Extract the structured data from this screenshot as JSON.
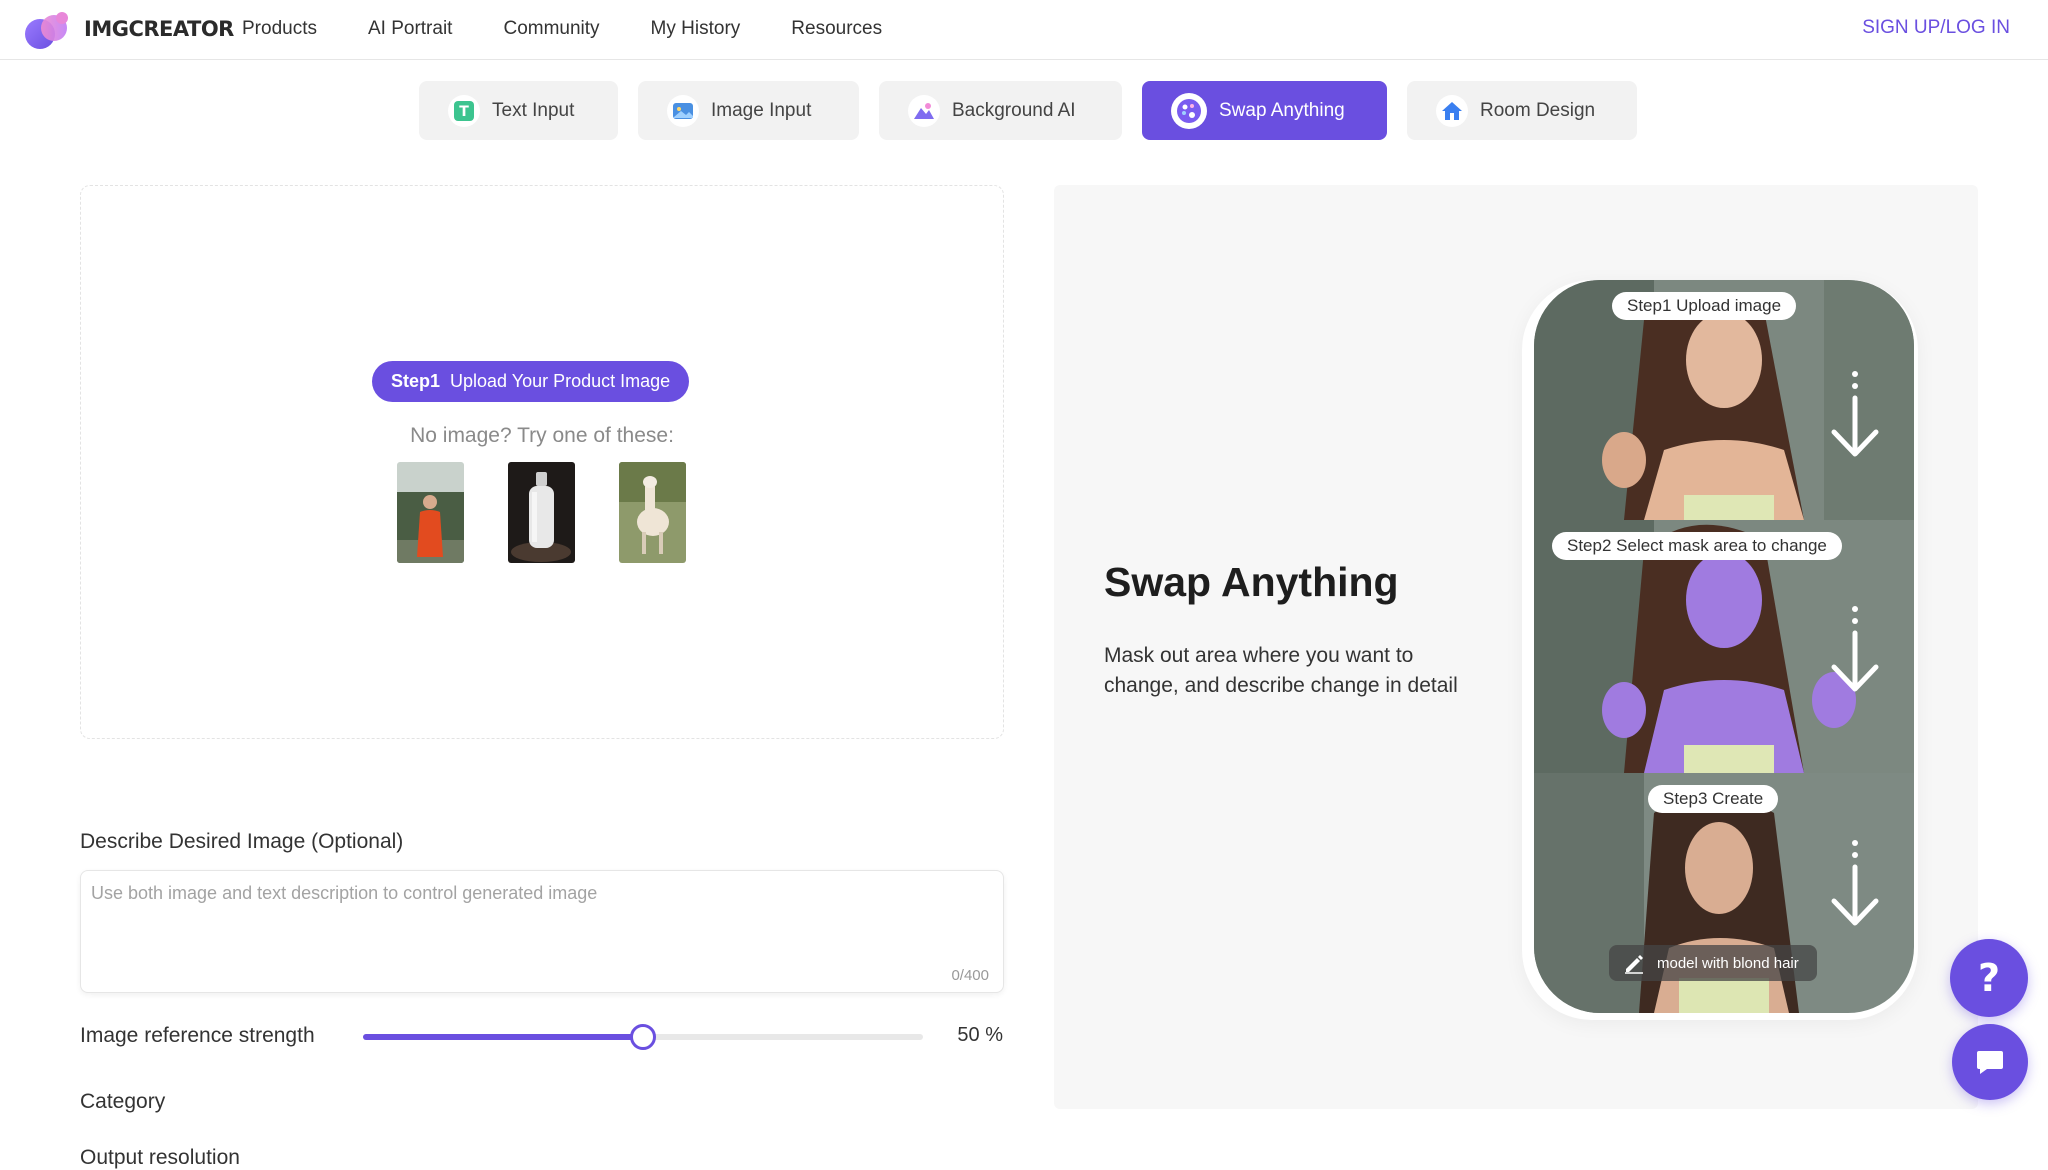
{
  "header": {
    "logo_text": "IMGCREATOR",
    "nav": [
      "Products",
      "AI Portrait",
      "Community",
      "My History",
      "Resources"
    ],
    "signup": "SIGN UP/LOG IN"
  },
  "tabs": [
    {
      "label": "Text Input",
      "icon": "text-icon"
    },
    {
      "label": "Image Input",
      "icon": "image-icon"
    },
    {
      "label": "Background AI",
      "icon": "background-icon"
    },
    {
      "label": "Swap Anything",
      "icon": "palette-icon",
      "active": true
    },
    {
      "label": "Room Design",
      "icon": "house-icon"
    }
  ],
  "upload": {
    "step_label": "Step1",
    "step_text": "Upload Your Product Image",
    "no_image_text": "No image? Try one of these:",
    "samples": [
      "woman-in-red-thumbnail",
      "white-bottle-thumbnail",
      "alpaca-thumbnail"
    ]
  },
  "describe": {
    "label": "Describe Desired Image (Optional)",
    "placeholder": "Use both image and text description to control generated image",
    "value": "",
    "counter": "0/400"
  },
  "strength": {
    "label": "Image reference strength",
    "value": 50,
    "value_text": "50 %"
  },
  "category_label": "Category",
  "output_label": "Output resolution",
  "preview": {
    "title": "Swap Anything",
    "description": "Mask out area where you want to change, and describe change in detail",
    "steps": [
      "Step1  Upload image",
      "Step2  Select mask area to change",
      "Step3  Create"
    ],
    "hint": "model with blond hair"
  },
  "fab": {
    "help": "?",
    "chat_icon": "chat-icon"
  },
  "colors": {
    "accent": "#6a4fe0",
    "mask": "#a07be0"
  }
}
